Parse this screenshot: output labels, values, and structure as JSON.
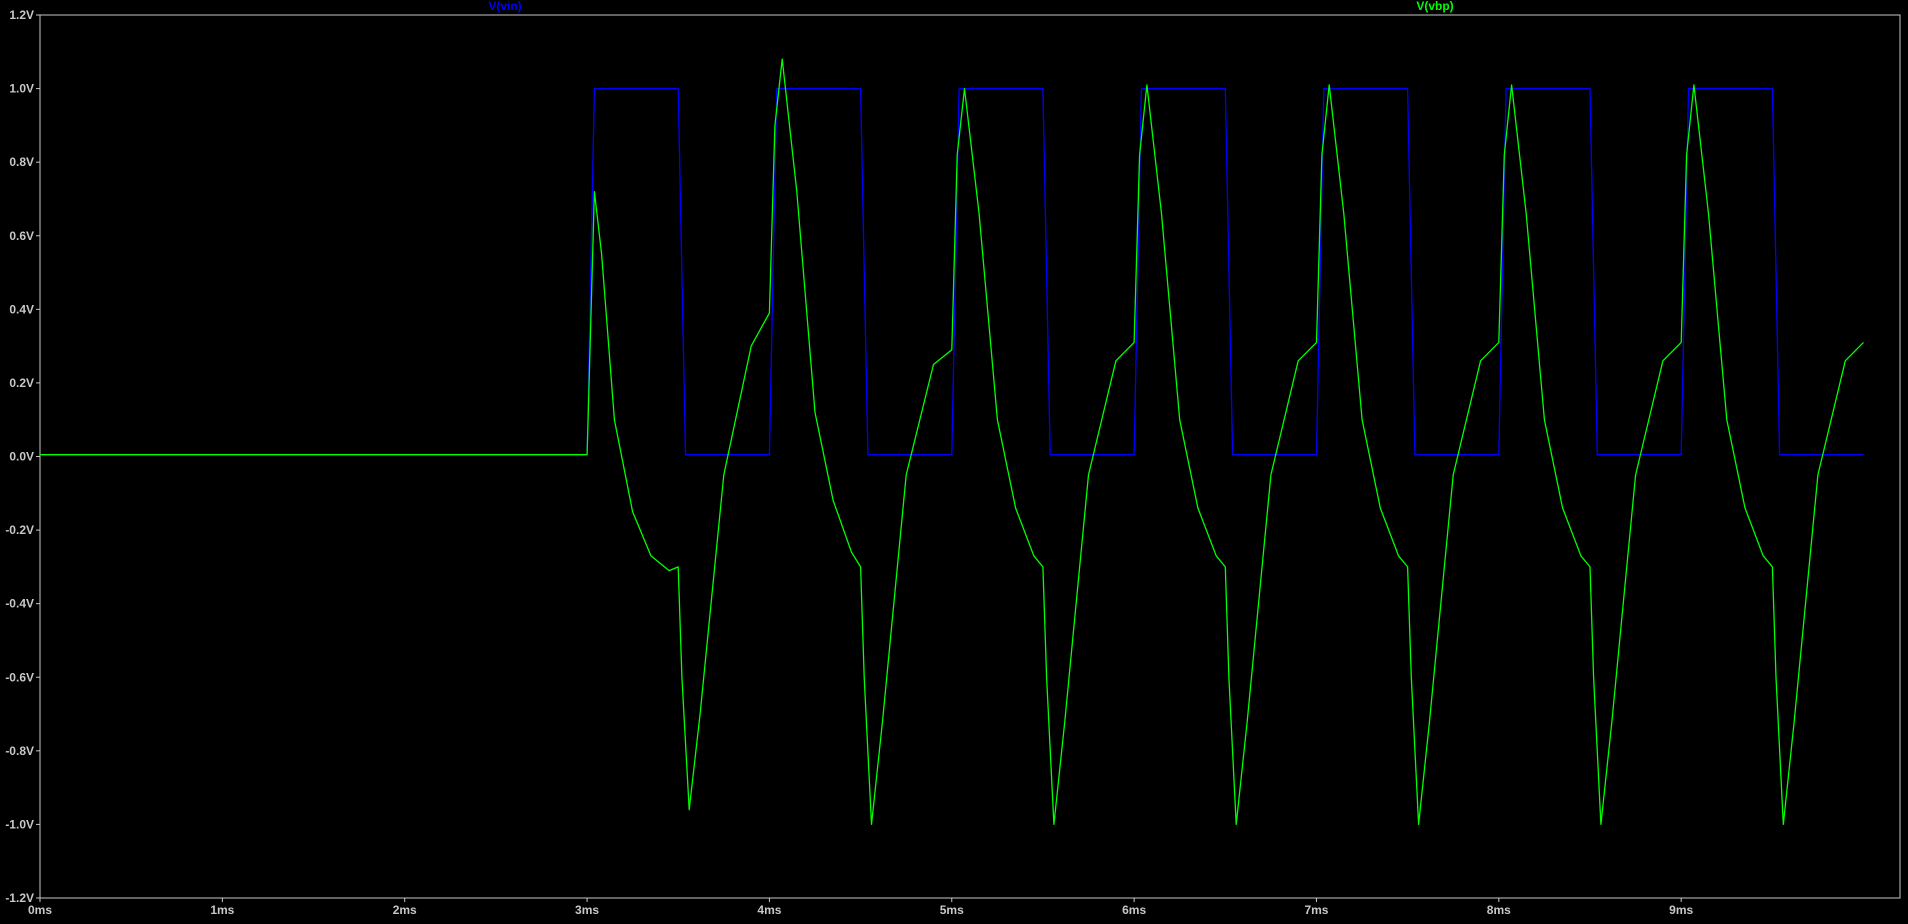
{
  "chart_data": {
    "type": "line",
    "title": "",
    "xlabel": "",
    "ylabel": "",
    "xlim": [
      0,
      10.2
    ],
    "ylim": [
      -1.2,
      1.2
    ],
    "x_unit": "ms",
    "y_unit": "V",
    "grid": false,
    "background_color": "#000000",
    "axis_color": "#c8c8c8",
    "x_ticks": [
      0,
      1,
      2,
      3,
      4,
      5,
      6,
      7,
      8,
      9
    ],
    "x_tick_labels": [
      "0ms",
      "1ms",
      "2ms",
      "3ms",
      "4ms",
      "5ms",
      "6ms",
      "7ms",
      "8ms",
      "9ms"
    ],
    "y_ticks": [
      1.2,
      1.0,
      0.8,
      0.6,
      0.4,
      0.2,
      0.0,
      -0.2,
      -0.4,
      -0.6,
      -0.8,
      -1.0,
      -1.2
    ],
    "y_tick_labels": [
      "1.2V",
      "1.0V",
      "0.8V",
      "0.6V",
      "0.4V",
      "0.2V",
      "0.0V",
      "-0.2V",
      "-0.4V",
      "-0.6V",
      "-0.8V",
      "-1.0V",
      "-1.2V"
    ],
    "legend_placement": "top",
    "series": [
      {
        "name": "V(vin)",
        "color": "#0000ff",
        "x": [
          0,
          3.0,
          3.04,
          3.5,
          3.54,
          4.0,
          4.04,
          4.5,
          4.54,
          5.0,
          5.04,
          5.5,
          5.54,
          6.0,
          6.04,
          6.5,
          6.54,
          7.0,
          7.04,
          7.5,
          7.54,
          8.0,
          8.04,
          8.5,
          8.54,
          9.0,
          9.04,
          9.5,
          9.54,
          10.0
        ],
        "y": [
          0.005,
          0.005,
          1.0,
          1.0,
          0.005,
          0.005,
          1.0,
          1.0,
          0.005,
          0.005,
          1.0,
          1.0,
          0.005,
          0.005,
          1.0,
          1.0,
          0.005,
          0.005,
          1.0,
          1.0,
          0.005,
          0.005,
          1.0,
          1.0,
          0.005,
          0.005,
          1.0,
          1.0,
          0.005,
          0.005
        ]
      },
      {
        "name": "V(vbp)",
        "color": "#00ff00",
        "x": [
          0,
          3.0,
          3.04,
          3.08,
          3.15,
          3.25,
          3.35,
          3.45,
          3.5,
          3.52,
          3.56,
          3.62,
          3.75,
          3.9,
          4.0,
          4.03,
          4.07,
          4.15,
          4.25,
          4.35,
          4.45,
          4.5,
          4.52,
          4.56,
          4.62,
          4.75,
          4.9,
          5.0,
          5.03,
          5.07,
          5.15,
          5.25,
          5.35,
          5.45,
          5.5,
          5.52,
          5.56,
          5.62,
          5.75,
          5.9,
          6.0,
          6.03,
          6.07,
          6.15,
          6.25,
          6.35,
          6.45,
          6.5,
          6.52,
          6.56,
          6.62,
          6.75,
          6.9,
          7.0,
          7.03,
          7.07,
          7.15,
          7.25,
          7.35,
          7.45,
          7.5,
          7.52,
          7.56,
          7.62,
          7.75,
          7.9,
          8.0,
          8.03,
          8.07,
          8.15,
          8.25,
          8.35,
          8.45,
          8.5,
          8.52,
          8.56,
          8.62,
          8.75,
          8.9,
          9.0,
          9.03,
          9.07,
          9.15,
          9.25,
          9.35,
          9.45,
          9.5,
          9.52,
          9.56,
          9.62,
          9.75,
          9.9,
          10.0
        ],
        "y": [
          0.005,
          0.005,
          0.72,
          0.55,
          0.1,
          -0.15,
          -0.27,
          -0.31,
          -0.3,
          -0.6,
          -0.96,
          -0.7,
          -0.05,
          0.3,
          0.39,
          0.9,
          1.08,
          0.72,
          0.12,
          -0.12,
          -0.26,
          -0.3,
          -0.6,
          -1.0,
          -0.72,
          -0.05,
          0.25,
          0.29,
          0.82,
          1.0,
          0.66,
          0.1,
          -0.14,
          -0.27,
          -0.3,
          -0.6,
          -1.0,
          -0.72,
          -0.05,
          0.26,
          0.31,
          0.82,
          1.01,
          0.66,
          0.1,
          -0.14,
          -0.27,
          -0.3,
          -0.6,
          -1.0,
          -0.72,
          -0.05,
          0.26,
          0.31,
          0.82,
          1.01,
          0.66,
          0.1,
          -0.14,
          -0.27,
          -0.3,
          -0.6,
          -1.0,
          -0.72,
          -0.05,
          0.26,
          0.31,
          0.82,
          1.01,
          0.66,
          0.1,
          -0.14,
          -0.27,
          -0.3,
          -0.6,
          -1.0,
          -0.72,
          -0.05,
          0.26,
          0.31,
          0.82,
          1.01,
          0.66,
          0.1,
          -0.14,
          -0.27,
          -0.3,
          -0.6,
          -1.0,
          -0.72,
          -0.05,
          0.26,
          0.31
        ]
      }
    ]
  }
}
